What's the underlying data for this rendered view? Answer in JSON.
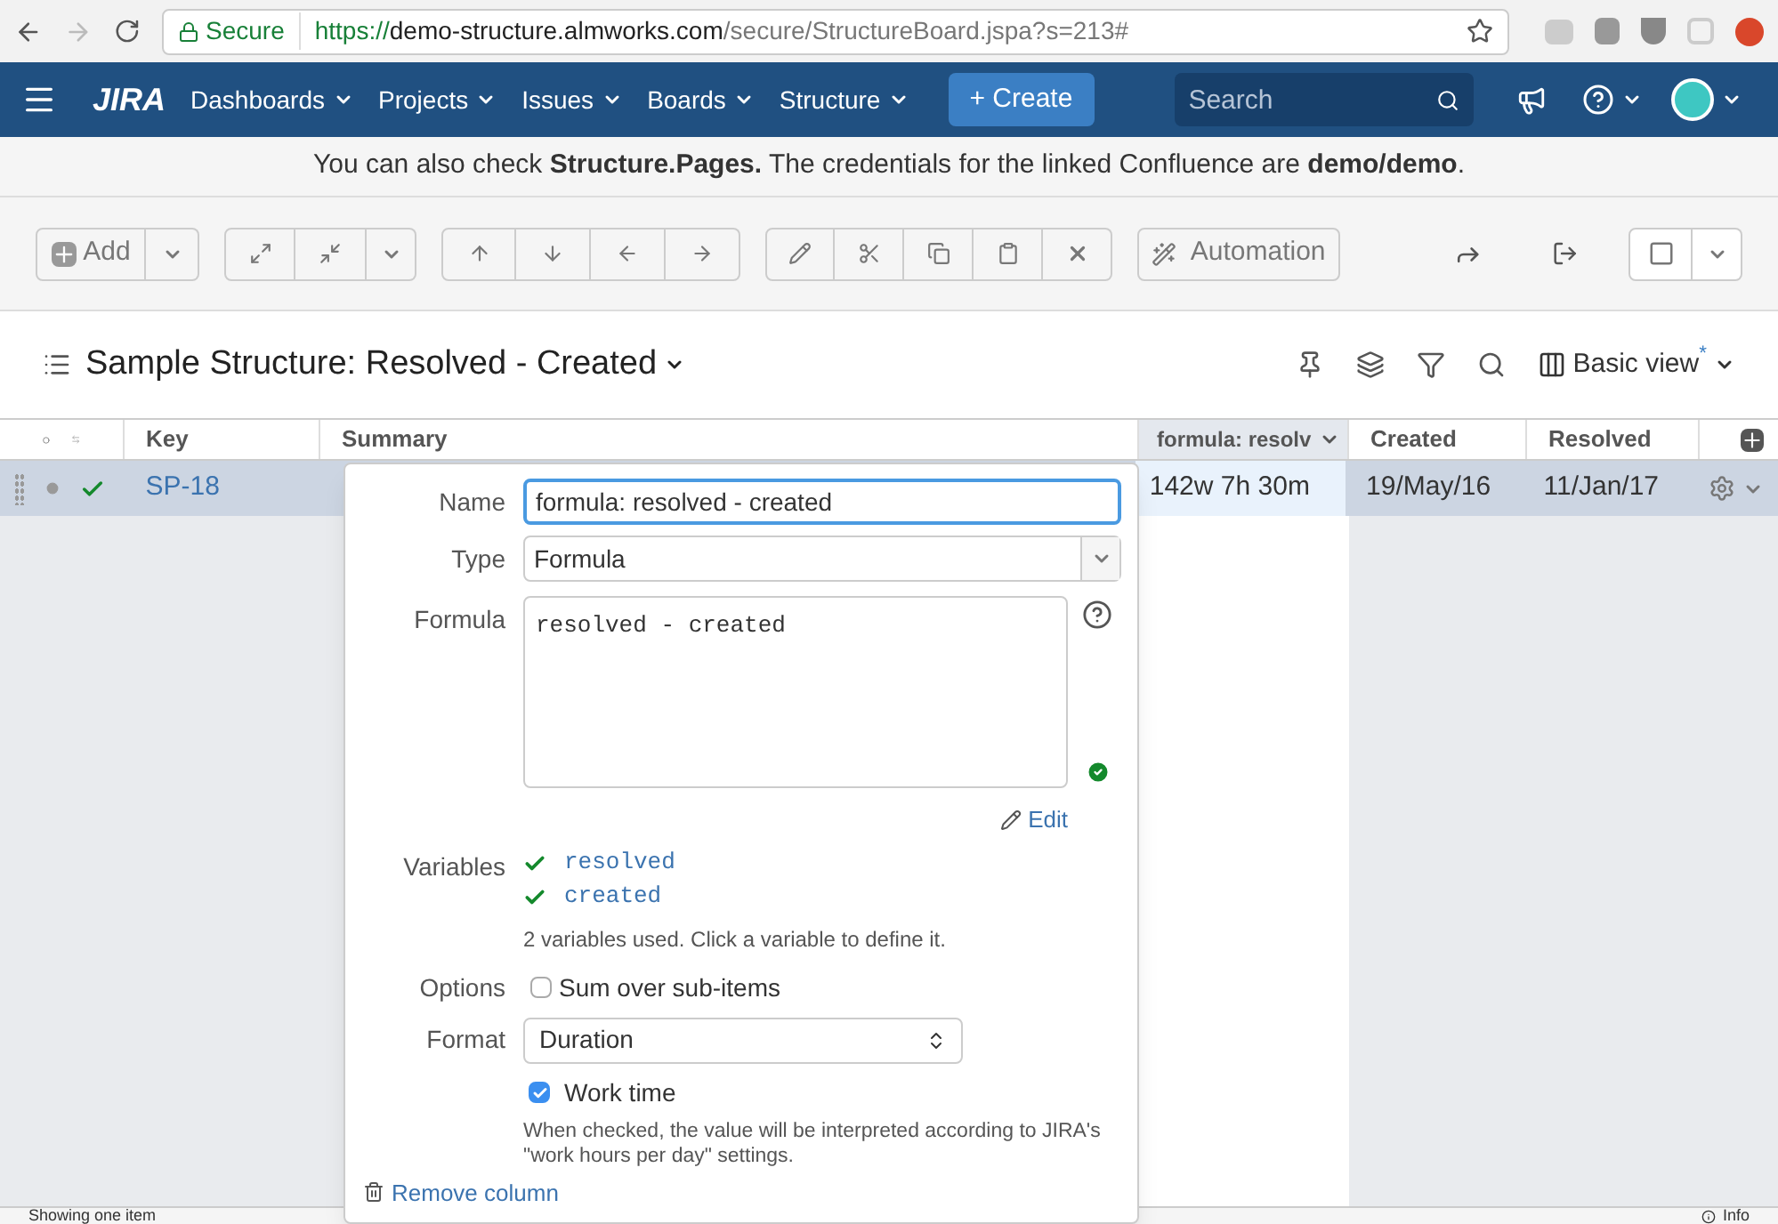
{
  "browser": {
    "secure": "Secure",
    "url_scheme": "https://",
    "url_host": "demo-structure.almworks.com",
    "url_path": "/secure/StructureBoard.jspa?s=213#"
  },
  "nav": {
    "logo": "JIRA",
    "menus": [
      "Dashboards",
      "Projects",
      "Issues",
      "Boards",
      "Structure"
    ],
    "create": "+ Create",
    "search_placeholder": "Search"
  },
  "banner": "You can also check **Structure.Pages.** The credentials for the linked Confluence are **demo/demo**.",
  "toolbar": {
    "add": "Add",
    "automation": "Automation"
  },
  "structure": {
    "title": "Sample Structure: Resolved - Created",
    "view": "Basic view",
    "view_modified": "*"
  },
  "columns": [
    "Key",
    "Summary",
    "formula: resolv",
    "Created",
    "Resolved"
  ],
  "rows": [
    {
      "key": "SP-18",
      "formula": "142w 7h 30m",
      "created": "19/May/16",
      "resolved": "11/Jan/17",
      "selected": true
    }
  ],
  "editor": {
    "name_label": "Name",
    "name_value": "formula: resolved - created",
    "type_label": "Type",
    "type_value": "Formula",
    "formula_label": "Formula",
    "formula_value": "resolved - created",
    "edit": "Edit",
    "variables_label": "Variables",
    "variables": [
      {
        "name": "resolved",
        "defined": true
      },
      {
        "name": "created",
        "defined": true
      }
    ],
    "variables_hint": "2 variables used. Click a variable to define it.",
    "options_label": "Options",
    "sum_label": "Sum over sub-items",
    "sum_checked": false,
    "format_label": "Format",
    "format_value": "Duration",
    "work_time_label": "Work time",
    "work_time_checked": true,
    "work_time_hint": "When checked, the value will be interpreted according to JIRA's \"work hours per day\" settings.",
    "remove": "Remove column"
  },
  "status": {
    "text": "Showing one item",
    "info": "Info"
  }
}
